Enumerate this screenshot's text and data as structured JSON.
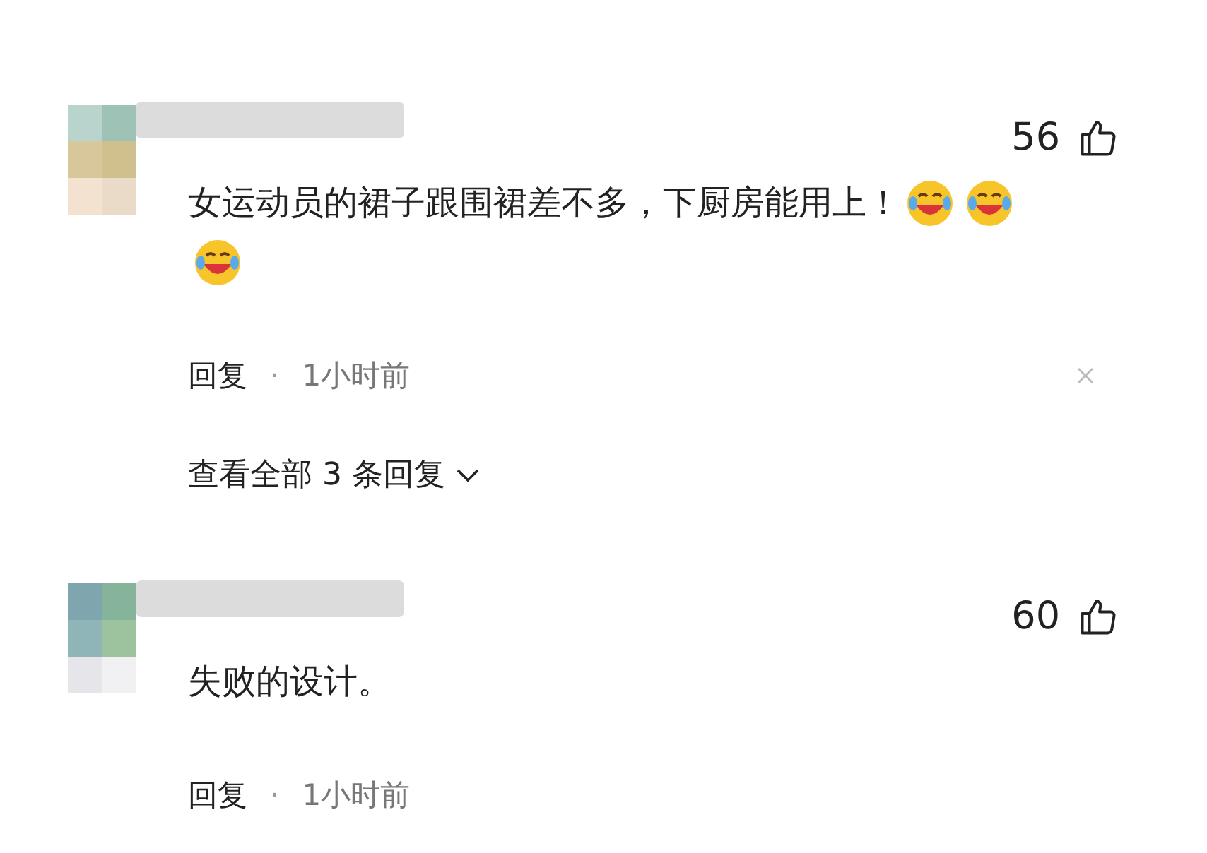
{
  "comments": [
    {
      "likes": "56",
      "text": "女运动员的裙子跟围裙差不多，下厨房能用上！",
      "emojis": [
        {
          "kind": "laughing-crying"
        },
        {
          "kind": "laughing-crying"
        },
        {
          "kind": "laughing-crying"
        }
      ],
      "reply_label": "回复",
      "separator": "·",
      "time": "1小时前",
      "show_close": true,
      "view_replies": "查看全部 3 条回复"
    },
    {
      "likes": "60",
      "text": "失败的设计。",
      "reply_label": "回复",
      "separator": "·",
      "time": "1小时前",
      "show_close": false
    }
  ]
}
